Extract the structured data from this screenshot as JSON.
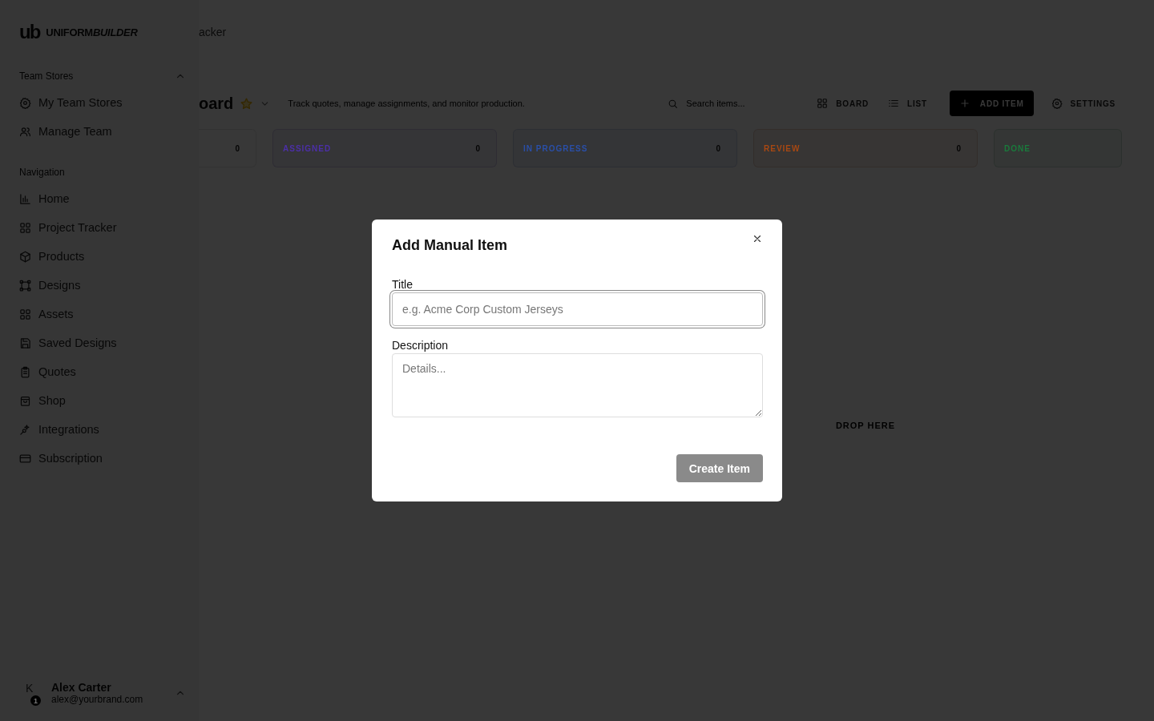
{
  "sidebar": {
    "brand": {
      "mark": "ub",
      "name_plain": "UNIFORM",
      "name_bold": "BUILDER"
    },
    "sections": [
      {
        "title": "Team Stores",
        "expanded": true,
        "items": [
          {
            "label": "My Team Stores"
          },
          {
            "label": "Manage Team"
          }
        ]
      },
      {
        "title": "Navigation",
        "items": [
          {
            "label": "Home"
          },
          {
            "label": "Project Tracker"
          },
          {
            "label": "Products"
          },
          {
            "label": "Designs"
          },
          {
            "label": "Assets"
          },
          {
            "label": "Saved Designs"
          },
          {
            "label": "Quotes"
          },
          {
            "label": "Shop"
          },
          {
            "label": "Integrations"
          },
          {
            "label": "Subscription"
          }
        ]
      }
    ],
    "user": {
      "initial": "K",
      "badge": "1",
      "name": "Alex Carter",
      "email": "alex@yourbrand.com"
    }
  },
  "header": {
    "breadcrumb": "acker"
  },
  "board": {
    "title": "oard",
    "favorite": true,
    "description": "Track quotes, manage assignments, and monitor production.",
    "search": {
      "placeholder": "Search items..."
    },
    "views": [
      {
        "label": "BOARD"
      },
      {
        "label": "LIST"
      }
    ],
    "add_button": "ADD ITEM",
    "settings_button": "SETTINGS",
    "columns": [
      {
        "count": "0"
      },
      {
        "label": "ASSIGNED",
        "count": "0",
        "color": "#4c2fa8"
      },
      {
        "label": "IN PROGRESS",
        "count": "0",
        "color": "#2a4fa8"
      },
      {
        "label": "REVIEW",
        "count": "0",
        "color": "#a84812",
        "drop_text": "DROP HERE"
      },
      {
        "label": "DONE",
        "color": "#1a7a3c"
      }
    ]
  },
  "modal": {
    "title": "Add Manual Item",
    "fields": [
      {
        "label": "Title",
        "kind": "input",
        "placeholder": "e.g. Acme Corp Custom Jerseys",
        "focused": true
      },
      {
        "label": "Description",
        "kind": "textarea",
        "placeholder": "Details...",
        "focused": false
      }
    ],
    "submit": {
      "label": "Create Item",
      "disabled": true
    }
  }
}
